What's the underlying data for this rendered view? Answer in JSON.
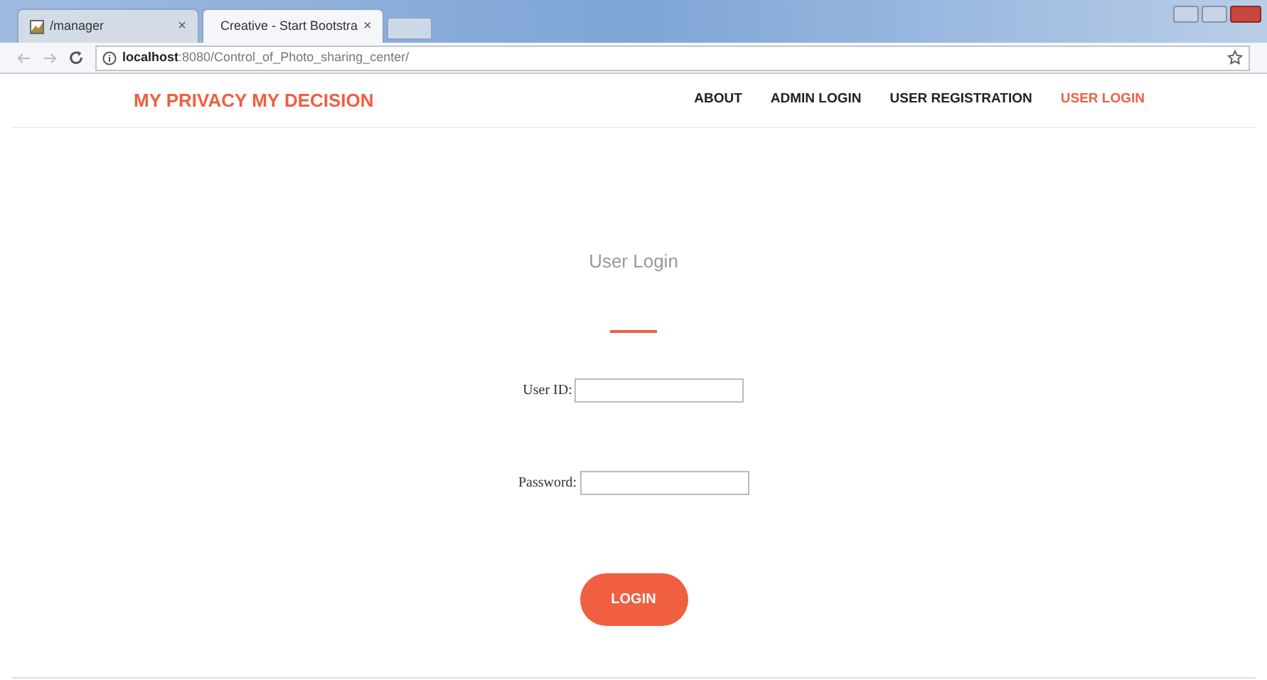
{
  "browser": {
    "tabs": [
      {
        "title": "/manager",
        "selected": false
      },
      {
        "title": "Creative - Start Bootstra",
        "selected": true
      }
    ],
    "close_glyph": "×",
    "address": "**localhost**:8080/Control_of_Photo_sharing_center/"
  },
  "navbar": {
    "brand": "MY PRIVACY MY DECISION",
    "items": [
      {
        "label": "ABOUT",
        "selected": false
      },
      {
        "label": "ADMIN LOGIN",
        "selected": false
      },
      {
        "label": "USER REGISTRATION",
        "selected": false
      },
      {
        "label": "USER LOGIN",
        "selected": true
      }
    ]
  },
  "form": {
    "heading": "User Login",
    "fields": [
      {
        "label": "User ID:"
      },
      {
        "label": "Password:"
      }
    ],
    "submit": "LOGIN"
  }
}
